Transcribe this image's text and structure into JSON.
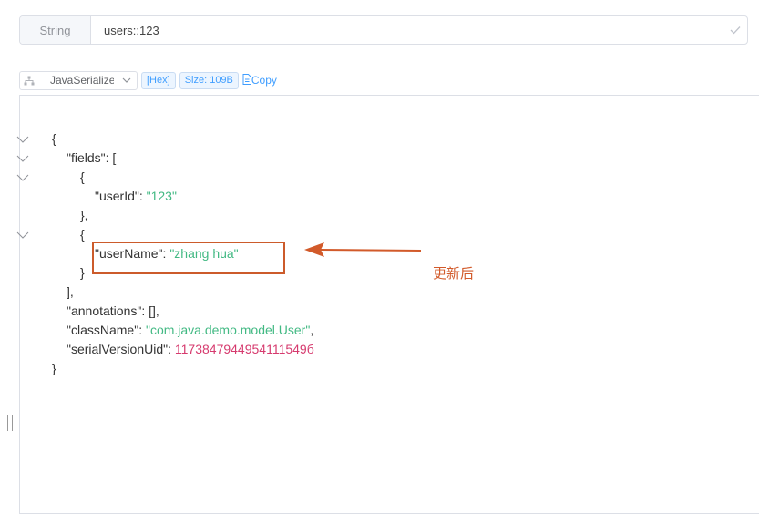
{
  "key_row": {
    "type_label": "String",
    "key_value": "users::123"
  },
  "toolbar": {
    "format_label": "JavaSerialize",
    "hex_tag": "[Hex]",
    "size_tag": "Size: 109B",
    "copy_label": "Copy"
  },
  "json": {
    "open_brace": "{",
    "fields_key": "\"fields\"",
    "fields_open": ": [",
    "obj1_open": "{",
    "userId_key": "\"userId\"",
    "userId_value": "\"123\"",
    "obj1_close": "},",
    "obj2_open": "{",
    "userName_key": "\"userName\"",
    "userName_value": "\"zhang hua\"",
    "obj2_close": "}",
    "fields_close": "],",
    "annotations_key": "\"annotations\"",
    "annotations_value": ": [],",
    "className_key": "\"className\"",
    "className_value": "\"com.java.demo.model.User\"",
    "serial_key": "\"serialVersionUid\"",
    "serial_value": "1173847944954111549б",
    "close_brace": "}"
  },
  "annotation": {
    "label": "更新后",
    "color": "#d25a2a"
  },
  "colors": {
    "string": "#42b983",
    "number": "#d63a6e",
    "accent": "#409eff"
  }
}
